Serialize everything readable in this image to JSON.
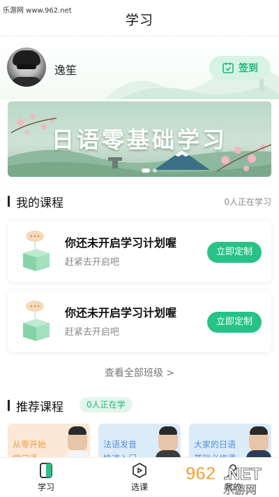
{
  "watermark_top": "乐游网 www.962.net",
  "header": {
    "title": "学习"
  },
  "profile": {
    "username": "逸笙",
    "signin_label": "签到"
  },
  "banner": {
    "title": "日语零基础学习",
    "slides": 2,
    "active_slide": 0
  },
  "my_courses": {
    "title": "我的课程",
    "meta": "0人正在学习",
    "cards": [
      {
        "title": "你还未开启学习计划喔",
        "subtitle": "赶紧去开启吧",
        "button": "立即定制"
      },
      {
        "title": "你还未开启学习计划喔",
        "subtitle": "赶紧去开启吧",
        "button": "立即定制"
      }
    ],
    "view_all": "查看全部班级 >"
  },
  "recommended": {
    "title": "推荐课程",
    "badge": "0人正在学",
    "tiles": [
      {
        "line1": "从零开始",
        "line2": "学口语",
        "color": "#f09a4a",
        "bg": "#fbe9d6"
      },
      {
        "line1": "法语发音",
        "line2": "快速入门",
        "color": "#4f8fd8",
        "bg": "#dcebf8"
      },
      {
        "line1": "大家的日语",
        "line2": "基础必修课",
        "color": "#4f8fd8",
        "bg": "#dcebf8"
      }
    ]
  },
  "tabbar": {
    "tabs": [
      {
        "label": "学习",
        "icon": "study-icon",
        "active": true
      },
      {
        "label": "选课",
        "icon": "play-course-icon",
        "active": false
      },
      {
        "label": "我的",
        "icon": "profile-icon",
        "active": false
      }
    ]
  },
  "watermark_bottom": {
    "brand": "962.NET",
    "sub": "乐游网"
  },
  "colors": {
    "accent": "#27c285",
    "accent_light": "#d6f3e4"
  }
}
